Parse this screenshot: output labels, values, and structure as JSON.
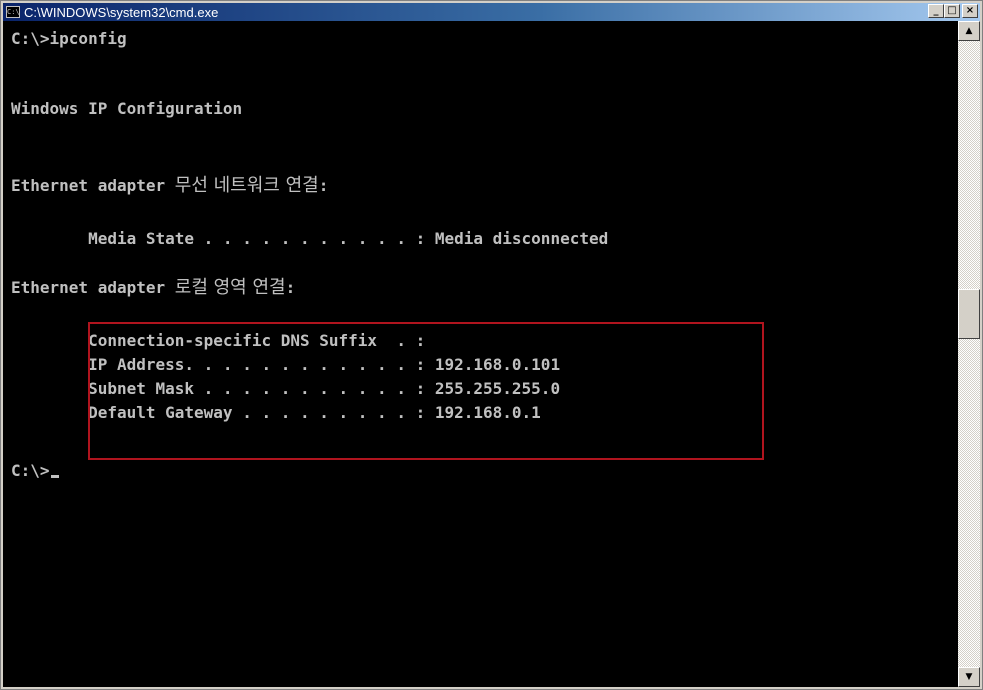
{
  "window": {
    "title": "C:\\WINDOWS\\system32\\cmd.exe",
    "icon_label": "C:\\",
    "buttons": {
      "minimize": "_",
      "maximize": "□",
      "close": "×"
    }
  },
  "console": {
    "lines": [
      {
        "pre": "C:\\>ipconfig",
        "ko": "",
        "post": ""
      },
      {
        "pre": "Windows IP Configuration",
        "ko": "",
        "post": ""
      },
      {
        "pre": "Ethernet adapter ",
        "ko": "무선 네트워크 연결",
        "post": ":"
      },
      {
        "pre": "        Media State . . . . . . . . . . . : Media disconnected",
        "ko": "",
        "post": ""
      },
      {
        "pre": "Ethernet adapter ",
        "ko": "로컬 영역 연결",
        "post": ":"
      },
      {
        "pre": "        Connection-specific DNS Suffix  . :",
        "ko": "",
        "post": ""
      },
      {
        "pre": "        IP Address. . . . . . . . . . . . : 192.168.0.101",
        "ko": "",
        "post": ""
      },
      {
        "pre": "        Subnet Mask . . . . . . . . . . . : 255.255.255.0",
        "ko": "",
        "post": ""
      },
      {
        "pre": "        Default Gateway . . . . . . . . . : 192.168.0.1",
        "ko": "",
        "post": ""
      },
      {
        "pre": "C:\\>",
        "ko": "",
        "post": ""
      }
    ]
  },
  "scrollbar": {
    "up_arrow": "▲",
    "down_arrow": "▼"
  },
  "colors": {
    "console_bg": "#000000",
    "console_fg": "#c0c0c0",
    "highlight_border": "#b0141e"
  }
}
